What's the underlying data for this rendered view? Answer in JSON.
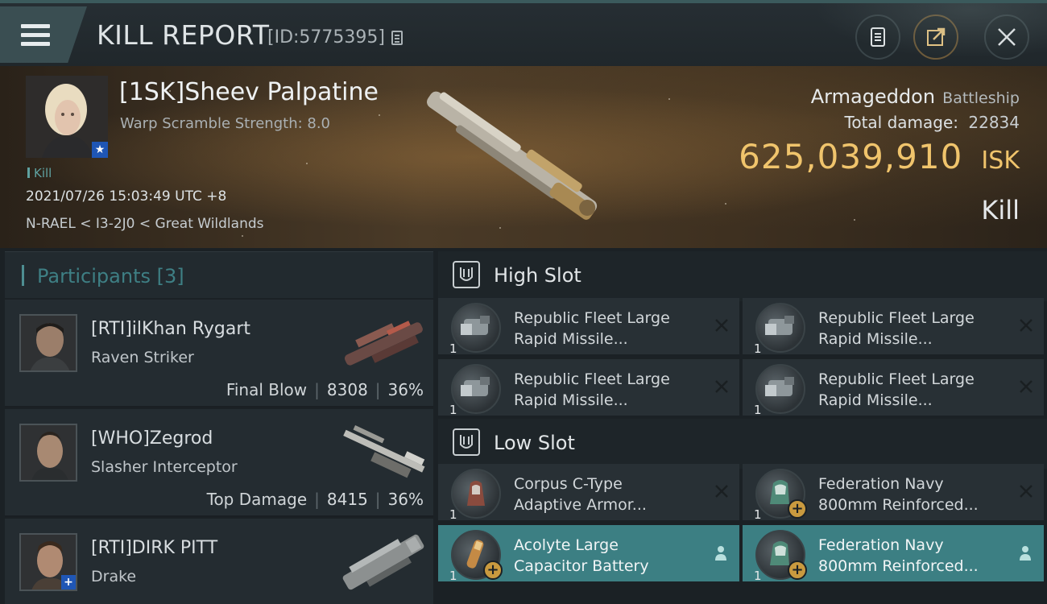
{
  "header": {
    "title": "KILL REPORT",
    "report_id": "[ID:5775395]"
  },
  "victim": {
    "name": "[1SK]Sheev Palpatine",
    "warp_scramble": "Warp Scramble Strength: 8.0",
    "tag": "Kill",
    "date": "2021/07/26 15:03:49 UTC +8",
    "location": "N-RAEL < I3-2J0 < Great Wildlands",
    "ship_name": "Armageddon",
    "ship_class": "Battleship",
    "damage_label": "Total damage:",
    "total_damage": "22834",
    "isk_value": "625,039,910",
    "isk_unit": "ISK",
    "result": "Kill"
  },
  "participants": {
    "title": "Participants",
    "count": "[3]",
    "list": [
      {
        "name": "[RTI]ilKhan Rygart",
        "ship": "Raven Striker",
        "label": "Final Blow",
        "damage": "8308",
        "percent": "36%"
      },
      {
        "name": "[WHO]Zegrod",
        "ship": "Slasher Interceptor",
        "label": "Top Damage",
        "damage": "8415",
        "percent": "36%"
      },
      {
        "name": "[RTI]DIRK PITT",
        "ship": "Drake",
        "label": "",
        "damage": "",
        "percent": ""
      }
    ]
  },
  "high_slot": {
    "title": "High Slot",
    "items": [
      {
        "line1": "Republic Fleet Large",
        "line2": "Rapid Missile...",
        "qty": "1"
      },
      {
        "line1": "Republic Fleet Large",
        "line2": "Rapid Missile...",
        "qty": "1"
      },
      {
        "line1": "Republic Fleet Large",
        "line2": "Rapid Missile...",
        "qty": "1"
      },
      {
        "line1": "Republic Fleet Large",
        "line2": "Rapid Missile...",
        "qty": "1"
      }
    ]
  },
  "low_slot": {
    "title": "Low Slot",
    "items": [
      {
        "line1": "Corpus C-Type",
        "line2": "Adaptive Armor...",
        "qty": "1"
      },
      {
        "line1": "Federation Navy",
        "line2": "800mm Reinforced...",
        "qty": "1"
      },
      {
        "line1": "Acolyte Large",
        "line2": "Capacitor Battery",
        "qty": "1"
      },
      {
        "line1": "Federation Navy",
        "line2": "800mm Reinforced...",
        "qty": "1"
      }
    ]
  },
  "colors": {
    "accent_teal": "#3c7f83",
    "isk_gold": "#f0c46c",
    "badge_blue": "#1f56b5"
  }
}
